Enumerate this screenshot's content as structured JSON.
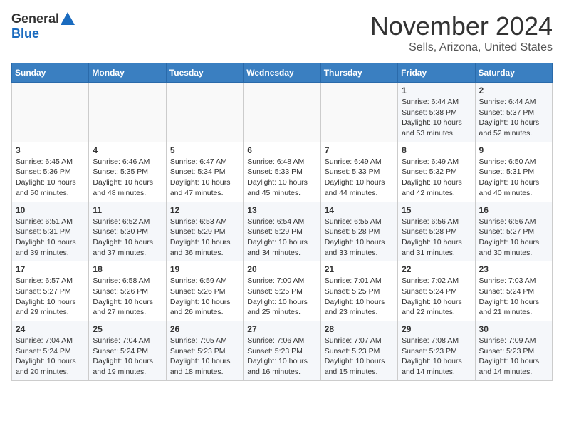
{
  "header": {
    "logo_general": "General",
    "logo_blue": "Blue",
    "month": "November 2024",
    "location": "Sells, Arizona, United States"
  },
  "calendar": {
    "headers": [
      "Sunday",
      "Monday",
      "Tuesday",
      "Wednesday",
      "Thursday",
      "Friday",
      "Saturday"
    ],
    "weeks": [
      [
        {
          "day": "",
          "info": ""
        },
        {
          "day": "",
          "info": ""
        },
        {
          "day": "",
          "info": ""
        },
        {
          "day": "",
          "info": ""
        },
        {
          "day": "",
          "info": ""
        },
        {
          "day": "1",
          "info": "Sunrise: 6:44 AM\nSunset: 5:38 PM\nDaylight: 10 hours and 53 minutes."
        },
        {
          "day": "2",
          "info": "Sunrise: 6:44 AM\nSunset: 5:37 PM\nDaylight: 10 hours and 52 minutes."
        }
      ],
      [
        {
          "day": "3",
          "info": "Sunrise: 6:45 AM\nSunset: 5:36 PM\nDaylight: 10 hours and 50 minutes."
        },
        {
          "day": "4",
          "info": "Sunrise: 6:46 AM\nSunset: 5:35 PM\nDaylight: 10 hours and 48 minutes."
        },
        {
          "day": "5",
          "info": "Sunrise: 6:47 AM\nSunset: 5:34 PM\nDaylight: 10 hours and 47 minutes."
        },
        {
          "day": "6",
          "info": "Sunrise: 6:48 AM\nSunset: 5:33 PM\nDaylight: 10 hours and 45 minutes."
        },
        {
          "day": "7",
          "info": "Sunrise: 6:49 AM\nSunset: 5:33 PM\nDaylight: 10 hours and 44 minutes."
        },
        {
          "day": "8",
          "info": "Sunrise: 6:49 AM\nSunset: 5:32 PM\nDaylight: 10 hours and 42 minutes."
        },
        {
          "day": "9",
          "info": "Sunrise: 6:50 AM\nSunset: 5:31 PM\nDaylight: 10 hours and 40 minutes."
        }
      ],
      [
        {
          "day": "10",
          "info": "Sunrise: 6:51 AM\nSunset: 5:31 PM\nDaylight: 10 hours and 39 minutes."
        },
        {
          "day": "11",
          "info": "Sunrise: 6:52 AM\nSunset: 5:30 PM\nDaylight: 10 hours and 37 minutes."
        },
        {
          "day": "12",
          "info": "Sunrise: 6:53 AM\nSunset: 5:29 PM\nDaylight: 10 hours and 36 minutes."
        },
        {
          "day": "13",
          "info": "Sunrise: 6:54 AM\nSunset: 5:29 PM\nDaylight: 10 hours and 34 minutes."
        },
        {
          "day": "14",
          "info": "Sunrise: 6:55 AM\nSunset: 5:28 PM\nDaylight: 10 hours and 33 minutes."
        },
        {
          "day": "15",
          "info": "Sunrise: 6:56 AM\nSunset: 5:28 PM\nDaylight: 10 hours and 31 minutes."
        },
        {
          "day": "16",
          "info": "Sunrise: 6:56 AM\nSunset: 5:27 PM\nDaylight: 10 hours and 30 minutes."
        }
      ],
      [
        {
          "day": "17",
          "info": "Sunrise: 6:57 AM\nSunset: 5:27 PM\nDaylight: 10 hours and 29 minutes."
        },
        {
          "day": "18",
          "info": "Sunrise: 6:58 AM\nSunset: 5:26 PM\nDaylight: 10 hours and 27 minutes."
        },
        {
          "day": "19",
          "info": "Sunrise: 6:59 AM\nSunset: 5:26 PM\nDaylight: 10 hours and 26 minutes."
        },
        {
          "day": "20",
          "info": "Sunrise: 7:00 AM\nSunset: 5:25 PM\nDaylight: 10 hours and 25 minutes."
        },
        {
          "day": "21",
          "info": "Sunrise: 7:01 AM\nSunset: 5:25 PM\nDaylight: 10 hours and 23 minutes."
        },
        {
          "day": "22",
          "info": "Sunrise: 7:02 AM\nSunset: 5:24 PM\nDaylight: 10 hours and 22 minutes."
        },
        {
          "day": "23",
          "info": "Sunrise: 7:03 AM\nSunset: 5:24 PM\nDaylight: 10 hours and 21 minutes."
        }
      ],
      [
        {
          "day": "24",
          "info": "Sunrise: 7:04 AM\nSunset: 5:24 PM\nDaylight: 10 hours and 20 minutes."
        },
        {
          "day": "25",
          "info": "Sunrise: 7:04 AM\nSunset: 5:24 PM\nDaylight: 10 hours and 19 minutes."
        },
        {
          "day": "26",
          "info": "Sunrise: 7:05 AM\nSunset: 5:23 PM\nDaylight: 10 hours and 18 minutes."
        },
        {
          "day": "27",
          "info": "Sunrise: 7:06 AM\nSunset: 5:23 PM\nDaylight: 10 hours and 16 minutes."
        },
        {
          "day": "28",
          "info": "Sunrise: 7:07 AM\nSunset: 5:23 PM\nDaylight: 10 hours and 15 minutes."
        },
        {
          "day": "29",
          "info": "Sunrise: 7:08 AM\nSunset: 5:23 PM\nDaylight: 10 hours and 14 minutes."
        },
        {
          "day": "30",
          "info": "Sunrise: 7:09 AM\nSunset: 5:23 PM\nDaylight: 10 hours and 14 minutes."
        }
      ]
    ]
  }
}
